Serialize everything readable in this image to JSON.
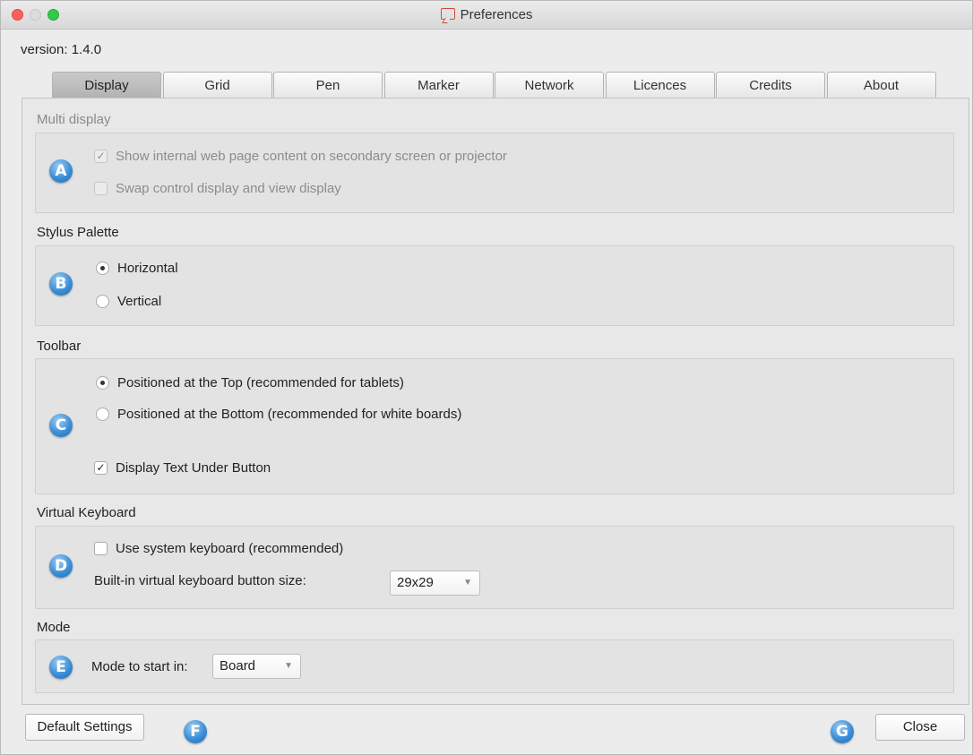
{
  "window": {
    "title": "Preferences",
    "title_icon": "presentation-board-icon"
  },
  "version_label": "version: 1.4.0",
  "tabs": [
    {
      "label": "Display",
      "active": true
    },
    {
      "label": "Grid"
    },
    {
      "label": "Pen"
    },
    {
      "label": "Marker"
    },
    {
      "label": "Network"
    },
    {
      "label": "Licences"
    },
    {
      "label": "Credits"
    },
    {
      "label": "About"
    }
  ],
  "multi_display": {
    "title": "Multi display",
    "badge": "A",
    "show_internal_label": "Show internal web page content on secondary screen or projector",
    "show_internal_checked": true,
    "swap_label": "Swap control display and view display",
    "swap_checked": false
  },
  "stylus_palette": {
    "title": "Stylus Palette",
    "badge": "B",
    "horizontal_label": "Horizontal",
    "vertical_label": "Vertical",
    "selected": "Horizontal"
  },
  "toolbar": {
    "title": "Toolbar",
    "badge": "C",
    "top_label": "Positioned at the Top (recommended for tablets)",
    "bottom_label": "Positioned at the Bottom (recommended for white boards)",
    "selected": "top",
    "text_under_label": "Display Text Under Button",
    "text_under_checked": true
  },
  "virtual_keyboard": {
    "title": "Virtual Keyboard",
    "badge": "D",
    "use_system_label": "Use system keyboard (recommended)",
    "use_system_checked": false,
    "size_label": "Built-in virtual keyboard button size:",
    "size_value": "29x29"
  },
  "mode": {
    "title": "Mode",
    "badge": "E",
    "start_label": "Mode to start in:",
    "start_value": "Board"
  },
  "footer": {
    "default_settings_label": "Default Settings",
    "badge_f": "F",
    "badge_g": "G",
    "close_label": "Close"
  },
  "colors": {
    "close_light": "#fc605b",
    "min_light": "#dcdcdc",
    "max_light": "#34c84a",
    "badge_blue": "#3c8ed6"
  }
}
